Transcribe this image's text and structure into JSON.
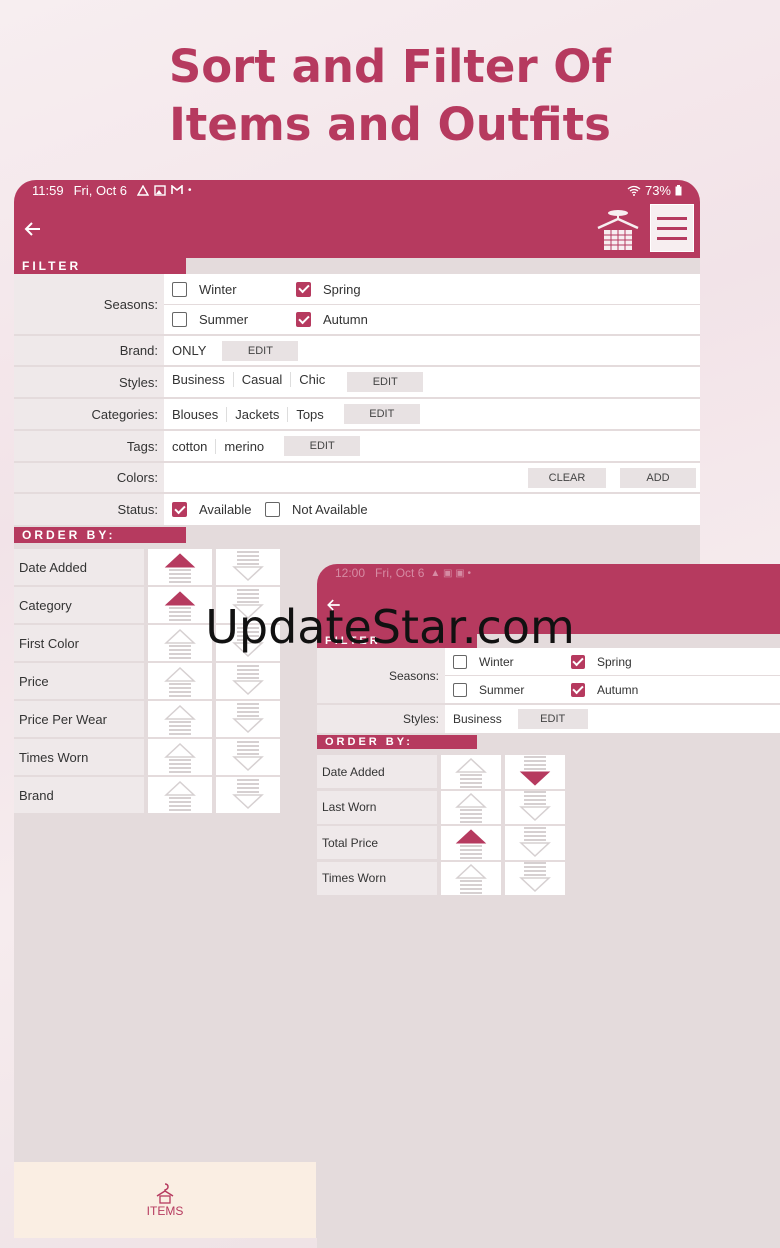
{
  "promo": {
    "line1": "Sort and Filter Of",
    "line2": "Items and Outfits"
  },
  "watermark": "UpdateStar.com",
  "main": {
    "status": {
      "time": "11:59",
      "date": "Fri, Oct 6",
      "battery": "73%"
    },
    "filter_header": "FILTER",
    "filter": {
      "seasons_label": "Seasons:",
      "seasons": [
        {
          "name": "Winter",
          "checked": false
        },
        {
          "name": "Spring",
          "checked": true
        },
        {
          "name": "Summer",
          "checked": false
        },
        {
          "name": "Autumn",
          "checked": true
        }
      ],
      "brand_label": "Brand:",
      "brand_value": "ONLY",
      "styles_label": "Styles:",
      "styles": [
        "Business",
        "Casual",
        "Chic"
      ],
      "categories_label": "Categories:",
      "categories": [
        "Blouses",
        "Jackets",
        "Tops"
      ],
      "tags_label": "Tags:",
      "tags": [
        "cotton",
        "merino"
      ],
      "colors_label": "Colors:",
      "status_label": "Status:",
      "status_available": "Available",
      "status_not_available": "Not Available",
      "edit_label": "EDIT",
      "clear_label": "CLEAR",
      "add_label": "ADD"
    },
    "order_header": "ORDER BY:",
    "order_rows": [
      {
        "label": "Date Added",
        "asc": true,
        "desc": false
      },
      {
        "label": "Category",
        "asc": true,
        "desc": false
      },
      {
        "label": "First Color",
        "asc": false,
        "desc": false
      },
      {
        "label": "Price",
        "asc": false,
        "desc": false
      },
      {
        "label": "Price Per Wear",
        "asc": false,
        "desc": false
      },
      {
        "label": "Times Worn",
        "asc": false,
        "desc": false
      },
      {
        "label": "Brand",
        "asc": false,
        "desc": false
      }
    ],
    "bottom_tab": "ITEMS"
  },
  "outfits": {
    "status": {
      "time": "12:00",
      "date": "Fri, Oct 6"
    },
    "filter_header": "FILTER",
    "seasons_label": "Seasons:",
    "seasons": [
      {
        "name": "Winter",
        "checked": false
      },
      {
        "name": "Spring",
        "checked": true
      },
      {
        "name": "Summer",
        "checked": false
      },
      {
        "name": "Autumn",
        "checked": true
      }
    ],
    "styles_label": "Styles:",
    "styles_value": "Business",
    "edit_label": "EDIT",
    "order_header": "ORDER BY:",
    "order_rows": [
      {
        "label": "Date Added",
        "asc": false,
        "desc": true
      },
      {
        "label": "Last Worn",
        "asc": false,
        "desc": false
      },
      {
        "label": "Total Price",
        "asc": true,
        "desc": false
      },
      {
        "label": "Times Worn",
        "asc": false,
        "desc": false
      }
    ]
  },
  "colors": {
    "accent": "#b63a5f",
    "panel": "#e4dbdc",
    "label_bg": "#efe9ea",
    "tab_bg": "#faeee3"
  }
}
